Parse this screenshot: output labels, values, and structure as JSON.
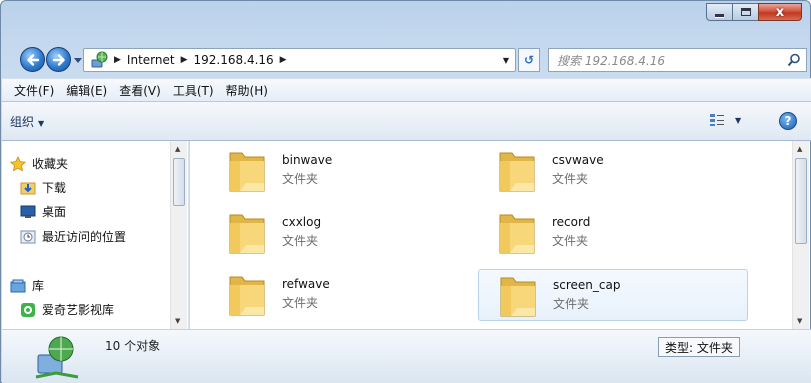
{
  "window": {
    "controls": {
      "minimize_icon": "minimize-icon",
      "maximize_icon": "maximize-icon",
      "close_glyph": "x"
    }
  },
  "address": {
    "breadcrumbs": [
      "Internet",
      "192.168.4.16"
    ],
    "refresh_glyph": "↺",
    "search_placeholder": "搜索 192.168.4.16"
  },
  "menu": {
    "items": [
      "文件(F)",
      "编辑(E)",
      "查看(V)",
      "工具(T)",
      "帮助(H)"
    ]
  },
  "toolbar": {
    "organize_label": "组织",
    "help_glyph": "?"
  },
  "nav_pane": {
    "items": [
      {
        "label": "收藏夹",
        "icon": "star-icon"
      },
      {
        "label": "下载",
        "icon": "download-folder-icon"
      },
      {
        "label": "桌面",
        "icon": "desktop-icon"
      },
      {
        "label": "最近访问的位置",
        "icon": "recent-places-icon"
      },
      {
        "label": "库",
        "icon": "library-icon"
      },
      {
        "label": "爱奇艺影视库",
        "icon": "iqiyi-icon"
      }
    ]
  },
  "files": [
    {
      "name": "binwave",
      "type": "文件夹"
    },
    {
      "name": "csvwave",
      "type": "文件夹"
    },
    {
      "name": "cxxlog",
      "type": "文件夹"
    },
    {
      "name": "record",
      "type": "文件夹"
    },
    {
      "name": "refwave",
      "type": "文件夹"
    },
    {
      "name": "screen_cap",
      "type": "文件夹",
      "selected": true
    }
  ],
  "details": {
    "object_count": "10 个对象",
    "type_filter": "类型: 文件夹"
  },
  "colors": {
    "frame": "#b9d1ea",
    "accent_blue": "#2f7bd0",
    "close_red": "#c0391f",
    "folder_yellow": "#f2cf6a"
  }
}
